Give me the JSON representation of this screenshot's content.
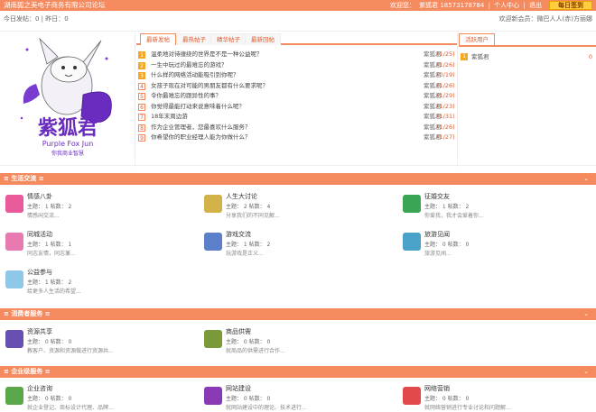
{
  "header": {
    "site_title": "湖南狐之美电子商务有限公司论坛",
    "welcome": "欢迎您：",
    "user": "紫狐君 18573178784",
    "user_center": "个人中心",
    "logout": "退出",
    "signin": "每日签到"
  },
  "stats": {
    "left": "今日发帖：0 | 昨日：0",
    "welcome_member": "欢迎新会员：微巴人人(赤)方丽娜"
  },
  "logo": {
    "title": "紫狐君",
    "subtitle": "Purple Fox Jun",
    "slogan": "你我商业智慧"
  },
  "latest_tabs": [
    "最新发帖",
    "最热帖子",
    "精华帖子",
    "最新回帖"
  ],
  "latest_posts": [
    {
      "num": "1",
      "title": "温柔地对待缠绕的世界是不是一种公益呢？",
      "author": "紫狐君",
      "count": "(1/25)"
    },
    {
      "num": "2",
      "title": "一生中玩过的最难忘的游戏？",
      "author": "紫狐君",
      "count": "(1/26)"
    },
    {
      "num": "3",
      "title": "什么样的网络活动能吸引到你呢？",
      "author": "紫狐君",
      "count": "(0/19)"
    },
    {
      "num": "4",
      "title": "女孩子现在对可能的男朋友都有什么要求呢？",
      "author": "紫狐君",
      "count": "(1/26)"
    },
    {
      "num": "5",
      "title": "令你最难忘的跟异性的事？",
      "author": "紫狐君",
      "count": "(1/29)"
    },
    {
      "num": "6",
      "title": "你觉得最能打动来说意味着什么呢？",
      "author": "紫狐君",
      "count": "(1/23)"
    },
    {
      "num": "7",
      "title": "18年末周边游",
      "author": "紫狐君",
      "count": "(1/31)"
    },
    {
      "num": "8",
      "title": "作为企业管理者，您最喜欢什么服务？",
      "author": "紫狐君",
      "count": "(1/26)"
    },
    {
      "num": "9",
      "title": "你希望你的职业经理人能为你做什么？",
      "author": "紫狐君",
      "count": "(1/27)"
    }
  ],
  "active_users": {
    "tab": "活跃用户",
    "rows": [
      {
        "num": "1",
        "name": "紫狐君",
        "count": "0"
      }
    ]
  },
  "sections": [
    {
      "title": "生活交流",
      "forums": [
        {
          "name": "情感八卦",
          "stat": "主题： 1  帖数： 2",
          "desc": "情感闲交流...",
          "color": "#e85a9a"
        },
        {
          "name": "人生大讨论",
          "stat": "主题： 2  帖数： 4",
          "desc": "分享我们的不同见解...",
          "color": "#d4b24a"
        },
        {
          "name": "征婚交友",
          "stat": "主题： 1  帖数： 2",
          "desc": "你爱我，我才会爱着你...",
          "color": "#3aa655"
        },
        {
          "name": "同城活动",
          "stat": "主题： 1  帖数： 1",
          "desc": "同志友情，同志兼...",
          "color": "#e97ab0"
        },
        {
          "name": "游戏交流",
          "stat": "主题： 1  帖数： 2",
          "desc": "玩游戏是正义...",
          "color": "#5d7fc9"
        },
        {
          "name": "旅游见闻",
          "stat": "主题： 0  帖数： 0",
          "desc": "旅游见闻...",
          "color": "#4aa1c9"
        },
        {
          "name": "公益参与",
          "stat": "主题： 1  帖数： 2",
          "desc": "给更多人生活的希望...",
          "color": "#8fc7e8"
        }
      ]
    },
    {
      "title": "消费者服务",
      "forums": [
        {
          "name": "资源共享",
          "stat": "主题： 0  帖数： 0",
          "desc": "教客户、资源和资源做进行资源共...",
          "color": "#6a4fb3"
        },
        {
          "name": "商品供需",
          "stat": "主题： 0  帖数： 0",
          "desc": "就商品的供需进行合作...",
          "color": "#7a9a3a"
        }
      ]
    },
    {
      "title": "企业级服务",
      "forums": [
        {
          "name": "企业咨询",
          "stat": "主题： 0  帖数： 0",
          "desc": "就企业登记、商标设计代理、品牌...",
          "color": "#5aa84a"
        },
        {
          "name": "网站建设",
          "stat": "主题： 0  帖数： 0",
          "desc": "就网站建设中的理论、技术进行...",
          "color": "#8a3ab5"
        },
        {
          "name": "网络营销",
          "stat": "主题： 0  帖数： 0",
          "desc": "就网络营销进行专业讨论和问题解...",
          "color": "#e04a4a"
        }
      ]
    }
  ],
  "section_arrow": "⌄"
}
